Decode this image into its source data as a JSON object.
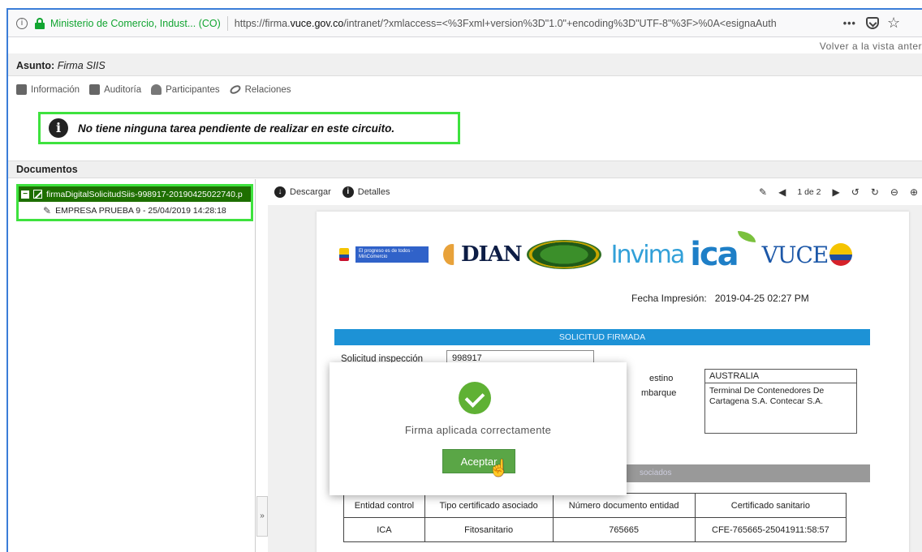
{
  "browser": {
    "site_identity": "Ministerio de Comercio, Indust... (CO)",
    "url_prefix": "https://firma.",
    "url_domain": "vuce.gov.co",
    "url_rest": "/intranet/?xmlaccess=<%3Fxml+version%3D\"1.0\"+encoding%3D\"UTF-8\"%3F>%0A<esignaAuth",
    "more_label": "•••"
  },
  "header": {
    "back_link": "Volver a la vista anter",
    "asunto_label": "Asunto:",
    "asunto_value": "Firma SIIS"
  },
  "tabs": [
    {
      "label": "Información",
      "icon": "info-doc-icon"
    },
    {
      "label": "Auditoría",
      "icon": "audit-icon"
    },
    {
      "label": "Participantes",
      "icon": "participants-icon"
    },
    {
      "label": "Relaciones",
      "icon": "link-icon"
    }
  ],
  "notice": {
    "text": "No tiene ninguna tarea pendiente de realizar en este circuito."
  },
  "documents": {
    "title": "Documentos",
    "file_name": "firmaDigitalSolicitudSiis-998917-20190425022740.p",
    "signature": "EMPRESA PRUEBA 9 - 25/04/2019 14:28:18",
    "splitter_label": "»"
  },
  "viewer": {
    "download_label": "Descargar",
    "details_label": "Detalles",
    "page_indicator": "1 de 2",
    "prev_label": "◀",
    "next_label": "▶"
  },
  "document": {
    "gov_text": "El progreso es de todos",
    "gov_sub": "MinComercio",
    "dian": "DIAN",
    "invima": "Invima",
    "ica": "ica",
    "vuce": "VUCE",
    "fecha_label": "Fecha Impresión:",
    "fecha_value": "2019-04-25 02:27 PM",
    "banner": "SOLICITUD FIRMADA",
    "solicitud_label": "Solicitud inspección",
    "solicitud_value": "998917",
    "destino_label": "estino",
    "embarque_label": "mbarque",
    "destino_value": "AUSTRALIA",
    "embarque_value": "Terminal De Contenedores De Cartagena S.A. Contecar S.A.",
    "asociados_label": "sociados",
    "table": {
      "headers": [
        "Entidad control",
        "Tipo certificado asociado",
        "Número documento entidad",
        "Certificado sanitario"
      ],
      "rows": [
        [
          "ICA",
          "Fitosanitario",
          "765665",
          "CFE-765665-25041911:58:57"
        ]
      ]
    }
  },
  "modal": {
    "message": "Firma aplicada correctamente",
    "accept_label": "Aceptar"
  }
}
